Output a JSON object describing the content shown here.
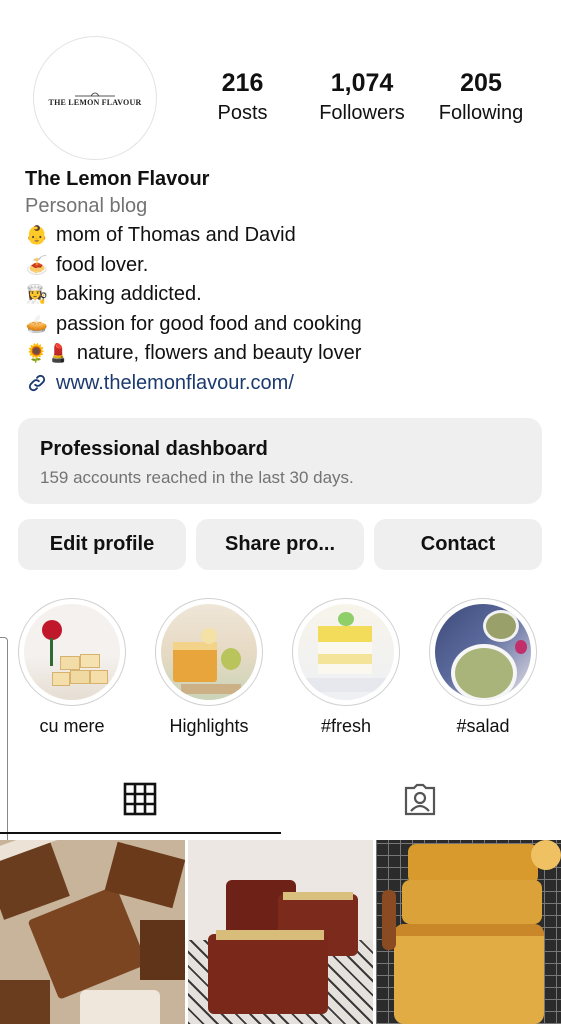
{
  "profile": {
    "avatar_logo_text": "THE LEMON FLAVOUR",
    "name": "The Lemon Flavour",
    "category": "Personal blog"
  },
  "stats": [
    {
      "value": "216",
      "label": "Posts"
    },
    {
      "value": "1,074",
      "label": "Followers"
    },
    {
      "value": "205",
      "label": "Following"
    }
  ],
  "bio": [
    {
      "icon": "baby-emoji",
      "glyph": "👶",
      "text": "mom of Thomas and David"
    },
    {
      "icon": "spaghetti-emoji",
      "glyph": "🍝",
      "text": "food lover."
    },
    {
      "icon": "cook-emoji",
      "glyph": "👩‍🍳",
      "text": "baking addicted."
    },
    {
      "icon": "pie-emoji",
      "glyph": "🥧",
      "text": "passion for good food and cooking"
    },
    {
      "icon": "sunflower-lipstick-emoji",
      "glyph": "🌻💄",
      "text": "nature, flowers and beauty lover"
    }
  ],
  "website": "www.thelemonflavour.com/",
  "dashboard": {
    "title": "Professional dashboard",
    "subtitle": "159 accounts reached in the last 30 days."
  },
  "buttons": {
    "edit": "Edit profile",
    "share": "Share pro...",
    "contact": "Contact"
  },
  "highlights": [
    {
      "label": "cu mere"
    },
    {
      "label": "Highlights"
    },
    {
      "label": "#fresh"
    },
    {
      "label": "#salad"
    }
  ],
  "tabs": [
    "grid-icon",
    "tagged-icon"
  ],
  "colors": {
    "link": "#1c3a6e",
    "secondary": "#737373",
    "button_bg": "#efefef"
  }
}
